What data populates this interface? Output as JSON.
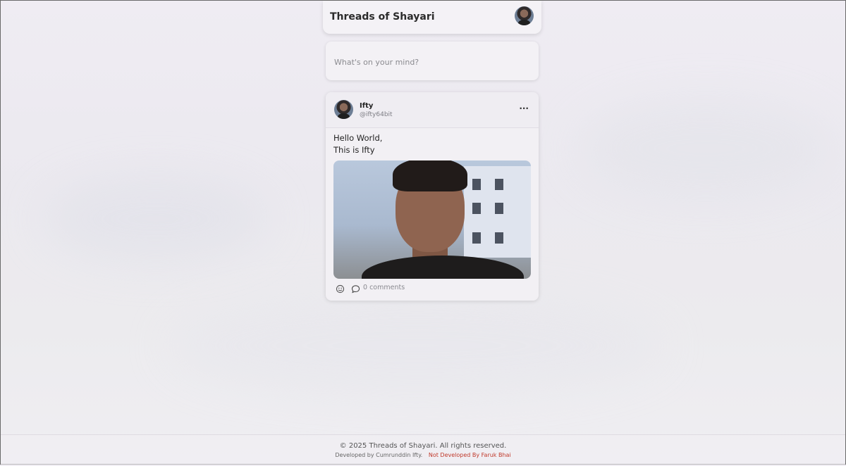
{
  "header": {
    "title": "Threads of Shayari",
    "avatar_icon": "user-avatar"
  },
  "composer": {
    "placeholder": "What's on your mind?"
  },
  "post": {
    "author_name": "Ifty",
    "author_handle": "@ifty64bit",
    "more_icon": "more-horizontal-icon",
    "more_label": "···",
    "text_line1": "Hello World,",
    "text_line2": "This is Ifty",
    "image_icon": "portrait-photo",
    "react_icon": "emoji-reaction-icon",
    "comment_icon": "comment-bubble-icon",
    "comments_label": "0 comments"
  },
  "footer": {
    "copyright": "© 2025 Threads of Shayari. All rights reserved.",
    "developed_by": "Developed by Cumrunddin Ifty.",
    "not_developed_by": "Not Developed By Faruk Bhai"
  },
  "colors": {
    "background": "#eeecf1",
    "card": "#f2f0f4",
    "text": "#222222",
    "muted": "#8a8a90",
    "accent_red": "#c0392b"
  }
}
